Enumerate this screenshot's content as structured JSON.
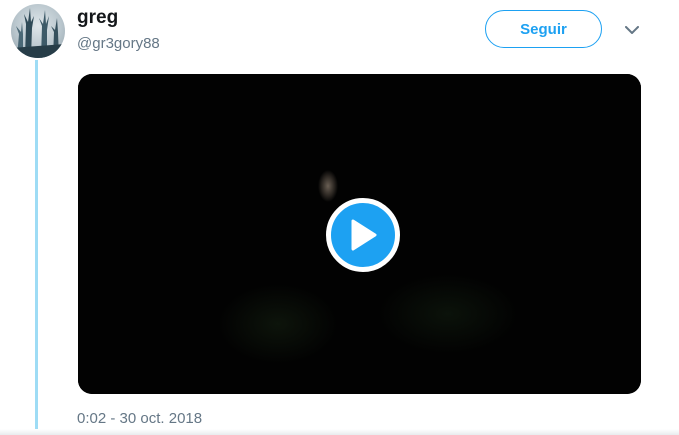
{
  "author": {
    "display_name": "greg",
    "handle": "@gr3gory88"
  },
  "actions": {
    "follow_label": "Seguir"
  },
  "media": {
    "type": "video",
    "play_icon": "play-icon"
  },
  "meta": {
    "timestamp": "0:02 - 30 oct. 2018"
  },
  "icons": {
    "caret": "chevron-down-icon",
    "avatar": "avatar"
  },
  "colors": {
    "accent": "#1da1f2",
    "thread_line": "#9edcf5",
    "secondary_text": "#657786",
    "primary_text": "#14171a"
  }
}
